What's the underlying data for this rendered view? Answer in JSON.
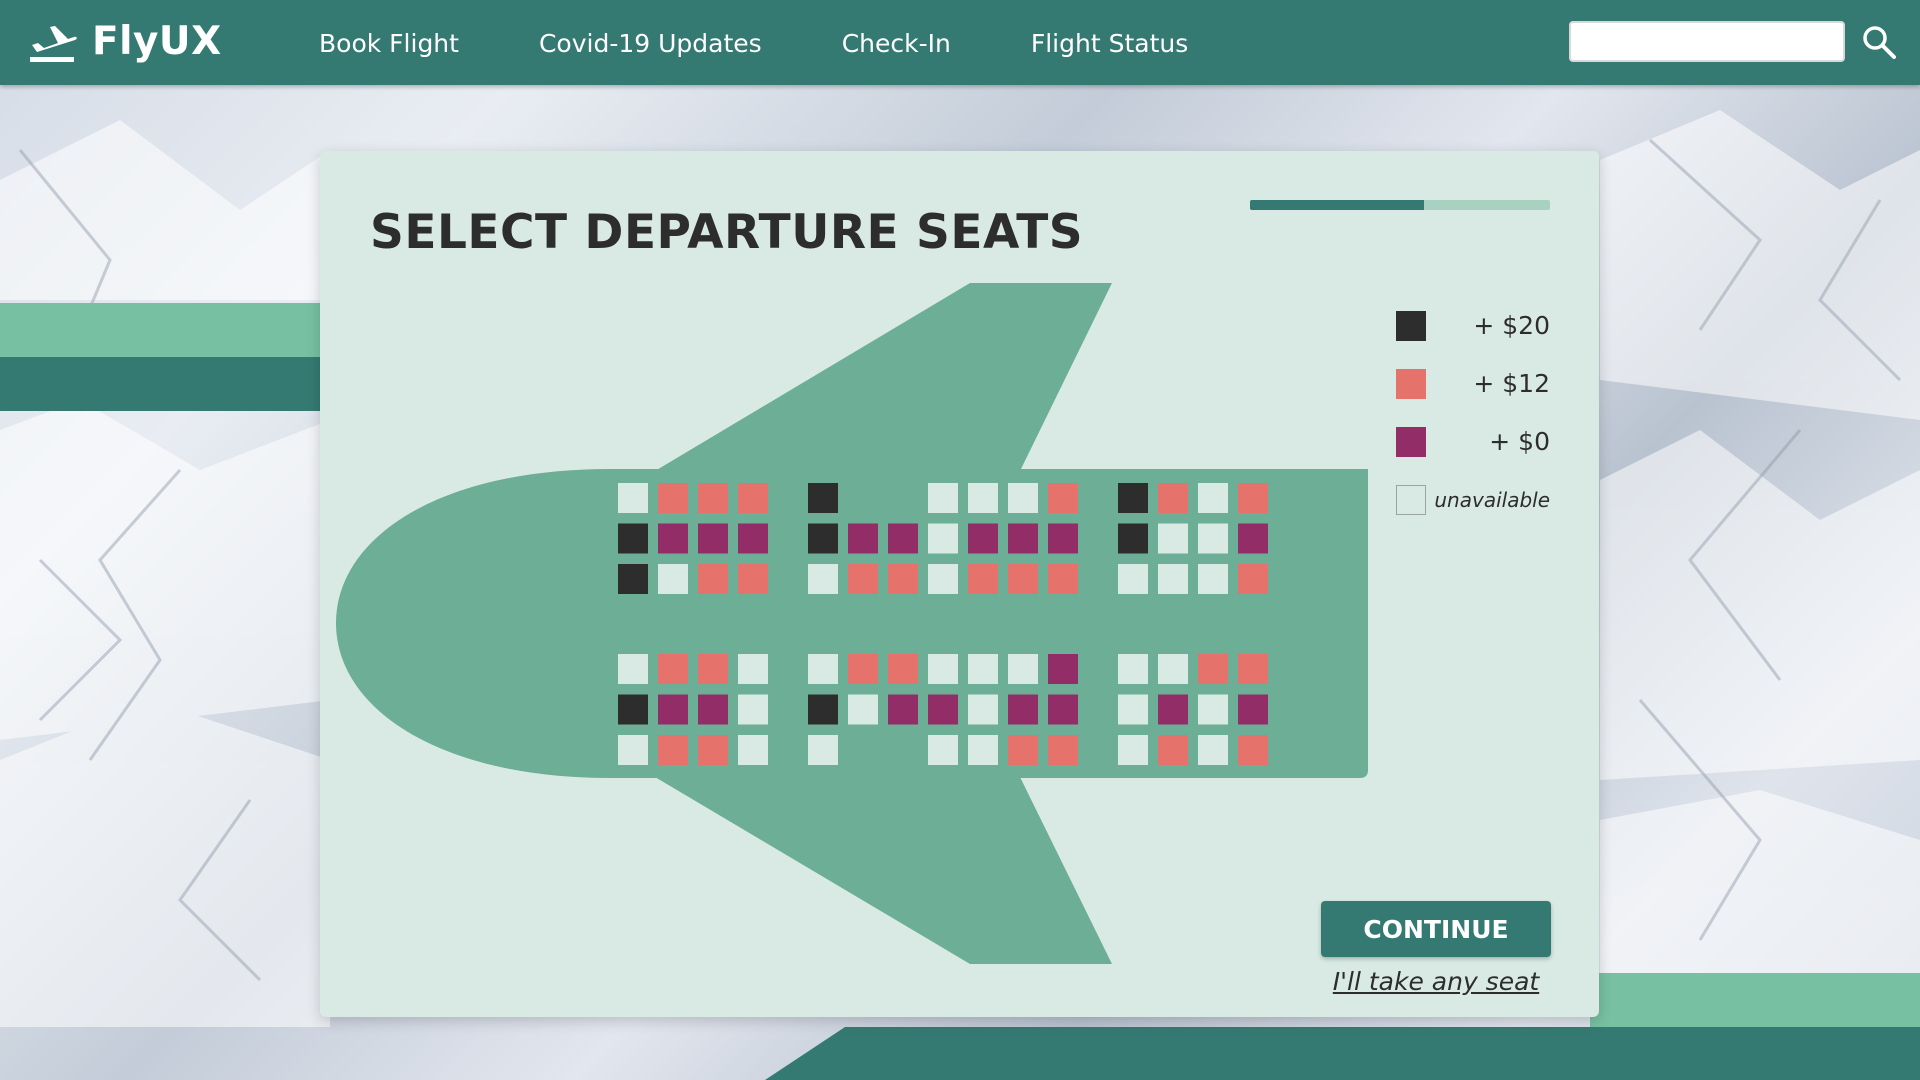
{
  "header": {
    "logo_text": "FlyUX",
    "logo_icon": "airplane-takeoff-icon",
    "nav": [
      "Book Flight",
      "Covid-19 Updates",
      "Check-In",
      "Flight Status"
    ],
    "search_placeholder": "",
    "search_icon": "search-icon"
  },
  "page": {
    "title": "SELECT DEPARTURE SEATS",
    "progress": 0.58,
    "continue_label": "CONTINUE",
    "any_seat_label": "I'll take any seat"
  },
  "legend": [
    {
      "key": "D",
      "label": "+ $20",
      "color": "#2d2d2d"
    },
    {
      "key": "S",
      "label": "+ $12",
      "color": "#e5736c"
    },
    {
      "key": "P",
      "label": "+ $0",
      "color": "#922d68"
    },
    {
      "key": "U",
      "label": "unavailable",
      "color": "#d9eae4"
    }
  ],
  "colors": {
    "header": "#357a72",
    "card": "#d9eae4",
    "plane": "#6cae96",
    "accent_light": "#78c0a2",
    "text": "#2d2d2d"
  },
  "seat_map": {
    "upper": [
      [
        "U",
        "S",
        "S",
        "S",
        "",
        "D",
        "",
        "",
        "U",
        "U",
        "U",
        "S",
        "",
        "D",
        "S",
        "U",
        "S"
      ],
      [
        "D",
        "P",
        "P",
        "P",
        "",
        "D",
        "P",
        "P",
        "U",
        "P",
        "P",
        "P",
        "",
        "D",
        "U",
        "U",
        "P"
      ],
      [
        "D",
        "U",
        "S",
        "S",
        "",
        "U",
        "S",
        "S",
        "U",
        "S",
        "S",
        "S",
        "",
        "U",
        "U",
        "U",
        "S"
      ]
    ],
    "lower": [
      [
        "U",
        "S",
        "S",
        "U",
        "",
        "U",
        "S",
        "S",
        "U",
        "U",
        "U",
        "P",
        "",
        "U",
        "U",
        "S",
        "S"
      ],
      [
        "D",
        "P",
        "P",
        "U",
        "",
        "D",
        "U",
        "P",
        "P",
        "U",
        "P",
        "P",
        "",
        "U",
        "P",
        "U",
        "P"
      ],
      [
        "U",
        "S",
        "S",
        "U",
        "",
        "U",
        "",
        "",
        "U",
        "U",
        "S",
        "S",
        "",
        "U",
        "S",
        "U",
        "S"
      ]
    ]
  }
}
